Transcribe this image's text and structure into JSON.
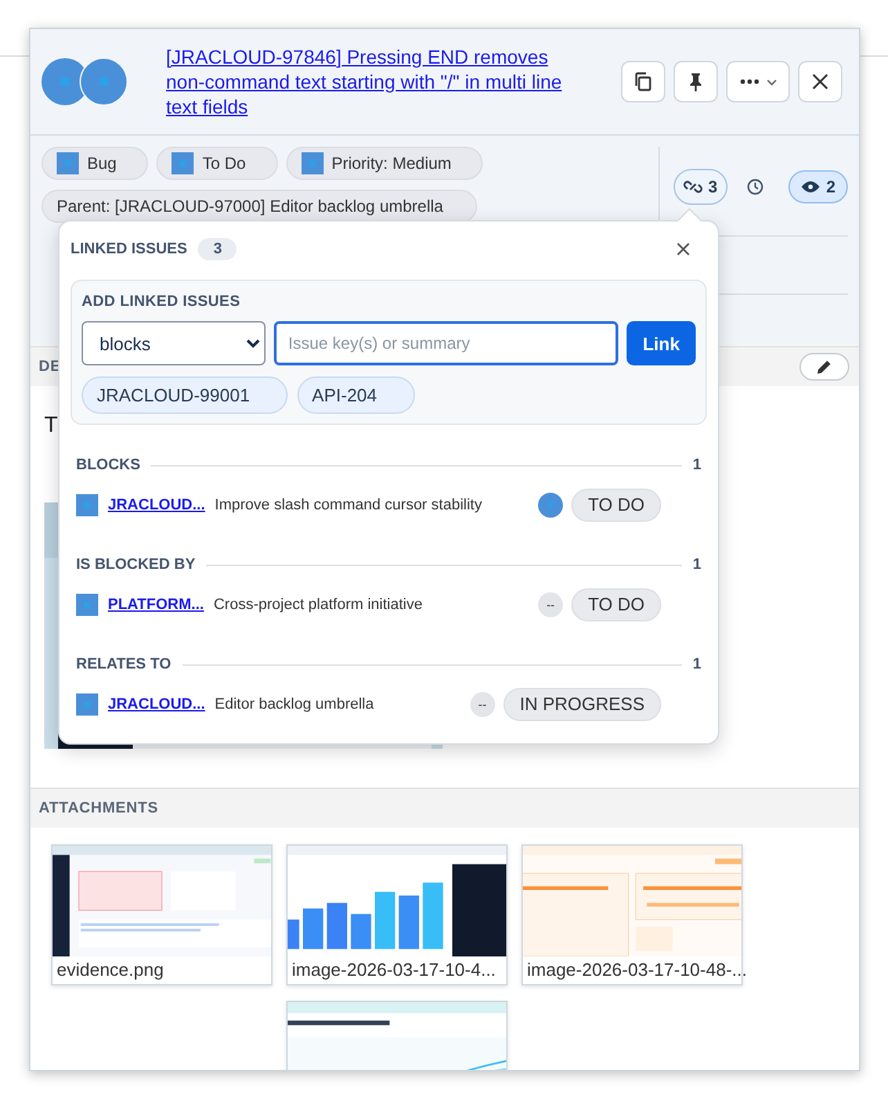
{
  "issue": {
    "title": "[JRACLOUD-97846] Pressing END removes non-command text starting with \"/\" in multi line text fields"
  },
  "header_buttons": [
    {
      "kind": "copy"
    },
    {
      "kind": "pin"
    },
    {
      "kind": "more"
    },
    {
      "kind": "close"
    }
  ],
  "tags": [
    {
      "label": "Bug",
      "kind": "icon"
    },
    {
      "label": "To Do",
      "kind": "icon"
    },
    {
      "label": "Priority: Medium",
      "kind": "icon"
    },
    {
      "label": "Parent: [JRACLOUD-97000] Editor backlog umbrella",
      "kind": "plain"
    }
  ],
  "side_actions": {
    "links": {
      "count": "3",
      "expanded": true
    },
    "watchers": {
      "count": "2",
      "watching": true
    }
  },
  "description": {
    "heading": "DE",
    "text": "T",
    "media": {
      "kind": "picture"
    }
  },
  "attachments": {
    "heading": "ATTACHMENTS",
    "items": [
      {
        "name": "evidence.png",
        "kind": "picture"
      },
      {
        "name": "image-2026-03-17-10-4...",
        "kind": "picture"
      },
      {
        "name": "image-2026-03-17-10-48-...",
        "kind": "picture"
      },
      {
        "kind": "picture"
      }
    ]
  },
  "linked_issues": {
    "title": "LINKED ISSUES",
    "count": "3",
    "add": {
      "label": "ADD LINKED ISSUES",
      "link_type": "blocks",
      "placeholder": "Issue key(s) or summary",
      "button": "Link",
      "chips": [
        "JRACLOUD-99001",
        "API-204"
      ]
    },
    "groups": [
      {
        "name": "BLOCKS",
        "count": "1",
        "issues": [
          {
            "key": "JRACLOUD...",
            "summary": "Improve slash command cursor stability",
            "assignee": {
              "kind": "avatar"
            },
            "status": "TO DO"
          }
        ]
      },
      {
        "name": "IS BLOCKED BY",
        "count": "1",
        "issues": [
          {
            "key": "PLATFORM...",
            "summary": "Cross-project platform initiative",
            "assignee": {
              "kind": "empty",
              "text": "--"
            },
            "status": "TO DO"
          }
        ]
      },
      {
        "name": "RELATES TO",
        "count": "1",
        "issues": [
          {
            "key": "JRACLOUD...",
            "summary": "Editor backlog umbrella",
            "assignee": {
              "kind": "empty",
              "text": "--"
            },
            "status": "IN PROGRESS"
          }
        ]
      }
    ]
  }
}
